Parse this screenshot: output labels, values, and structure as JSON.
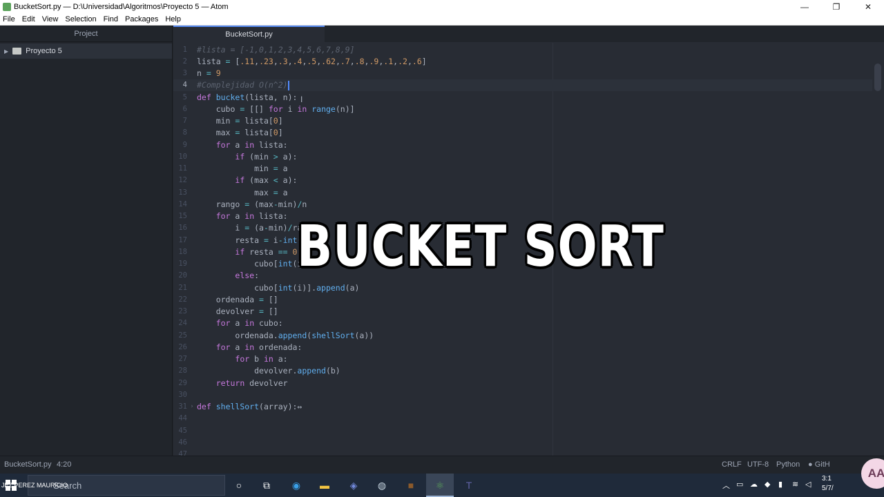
{
  "window": {
    "title": "BucketSort.py — D:\\Universidad\\Algoritmos\\Proyecto 5 — Atom",
    "minimize": "—",
    "maximize": "❐",
    "close": "✕"
  },
  "menu": [
    "File",
    "Edit",
    "View",
    "Selection",
    "Find",
    "Packages",
    "Help"
  ],
  "tree": {
    "header": "Project",
    "root": "Proyecto 5"
  },
  "tab": {
    "label": "BucketSort.py"
  },
  "code_lines": [
    {
      "n": "1",
      "t": "#lista = [-1,0,1,2,3,4,5,6,7,8,9]"
    },
    {
      "n": "2",
      "t": "lista = [.11,.23,.3,.4,.5,.62,.7,.8,.9,.1,.2,.6]"
    },
    {
      "n": "3",
      "t": "n = 9"
    },
    {
      "n": "4",
      "t": "#Complejidad O(n^2)"
    },
    {
      "n": "5",
      "t": "def bucket(lista, n):"
    },
    {
      "n": "6",
      "t": "    cubo = [[] for i in range(n)]"
    },
    {
      "n": "7",
      "t": "    min = lista[0]"
    },
    {
      "n": "8",
      "t": "    max = lista[0]"
    },
    {
      "n": "9",
      "t": "    for a in lista:"
    },
    {
      "n": "10",
      "t": "        if (min > a):"
    },
    {
      "n": "11",
      "t": "            min = a"
    },
    {
      "n": "12",
      "t": "        if (max < a):"
    },
    {
      "n": "13",
      "t": "            max = a"
    },
    {
      "n": "14",
      "t": "    rango = (max-min)/n"
    },
    {
      "n": "15",
      "t": "    for a in lista:"
    },
    {
      "n": "16",
      "t": "        i = (a-min)/ran"
    },
    {
      "n": "17",
      "t": "        resta = i-int(i"
    },
    {
      "n": "18",
      "t": "        if resta == 0 a"
    },
    {
      "n": "19",
      "t": "            cubo[int(i-"
    },
    {
      "n": "20",
      "t": "        else:"
    },
    {
      "n": "21",
      "t": "            cubo[int(i)].append(a)"
    },
    {
      "n": "22",
      "t": "    ordenada = []"
    },
    {
      "n": "23",
      "t": "    devolver = []"
    },
    {
      "n": "24",
      "t": "    for a in cubo:"
    },
    {
      "n": "25",
      "t": "        ordenada.append(shellSort(a))"
    },
    {
      "n": "26",
      "t": "    for a in ordenada:"
    },
    {
      "n": "27",
      "t": "        for b in a:"
    },
    {
      "n": "28",
      "t": "            devolver.append(b)"
    },
    {
      "n": "29",
      "t": "    return devolver"
    },
    {
      "n": "30",
      "t": ""
    },
    {
      "n": "31",
      "t": "def shellSort(array):↔"
    },
    {
      "n": "44",
      "t": ""
    },
    {
      "n": "45",
      "t": ""
    },
    {
      "n": "46",
      "t": ""
    },
    {
      "n": "47",
      "t": ""
    }
  ],
  "status": {
    "file": "BucketSort.py",
    "position": "4:20",
    "eol": "CRLF",
    "encoding": "UTF-8",
    "grammar": "Python",
    "github": "GitH"
  },
  "overlay_text": "BUCKET SORT",
  "taskbar": {
    "search_placeholder": "Search",
    "user_label": "JEZ PEREZ MAURICIO",
    "time": "3:1",
    "date": "5/7/"
  },
  "accessibility_badge": "AA",
  "colors": {
    "accent": "#568af2",
    "editor_bg": "#282c34",
    "panel_bg": "#21252b"
  }
}
